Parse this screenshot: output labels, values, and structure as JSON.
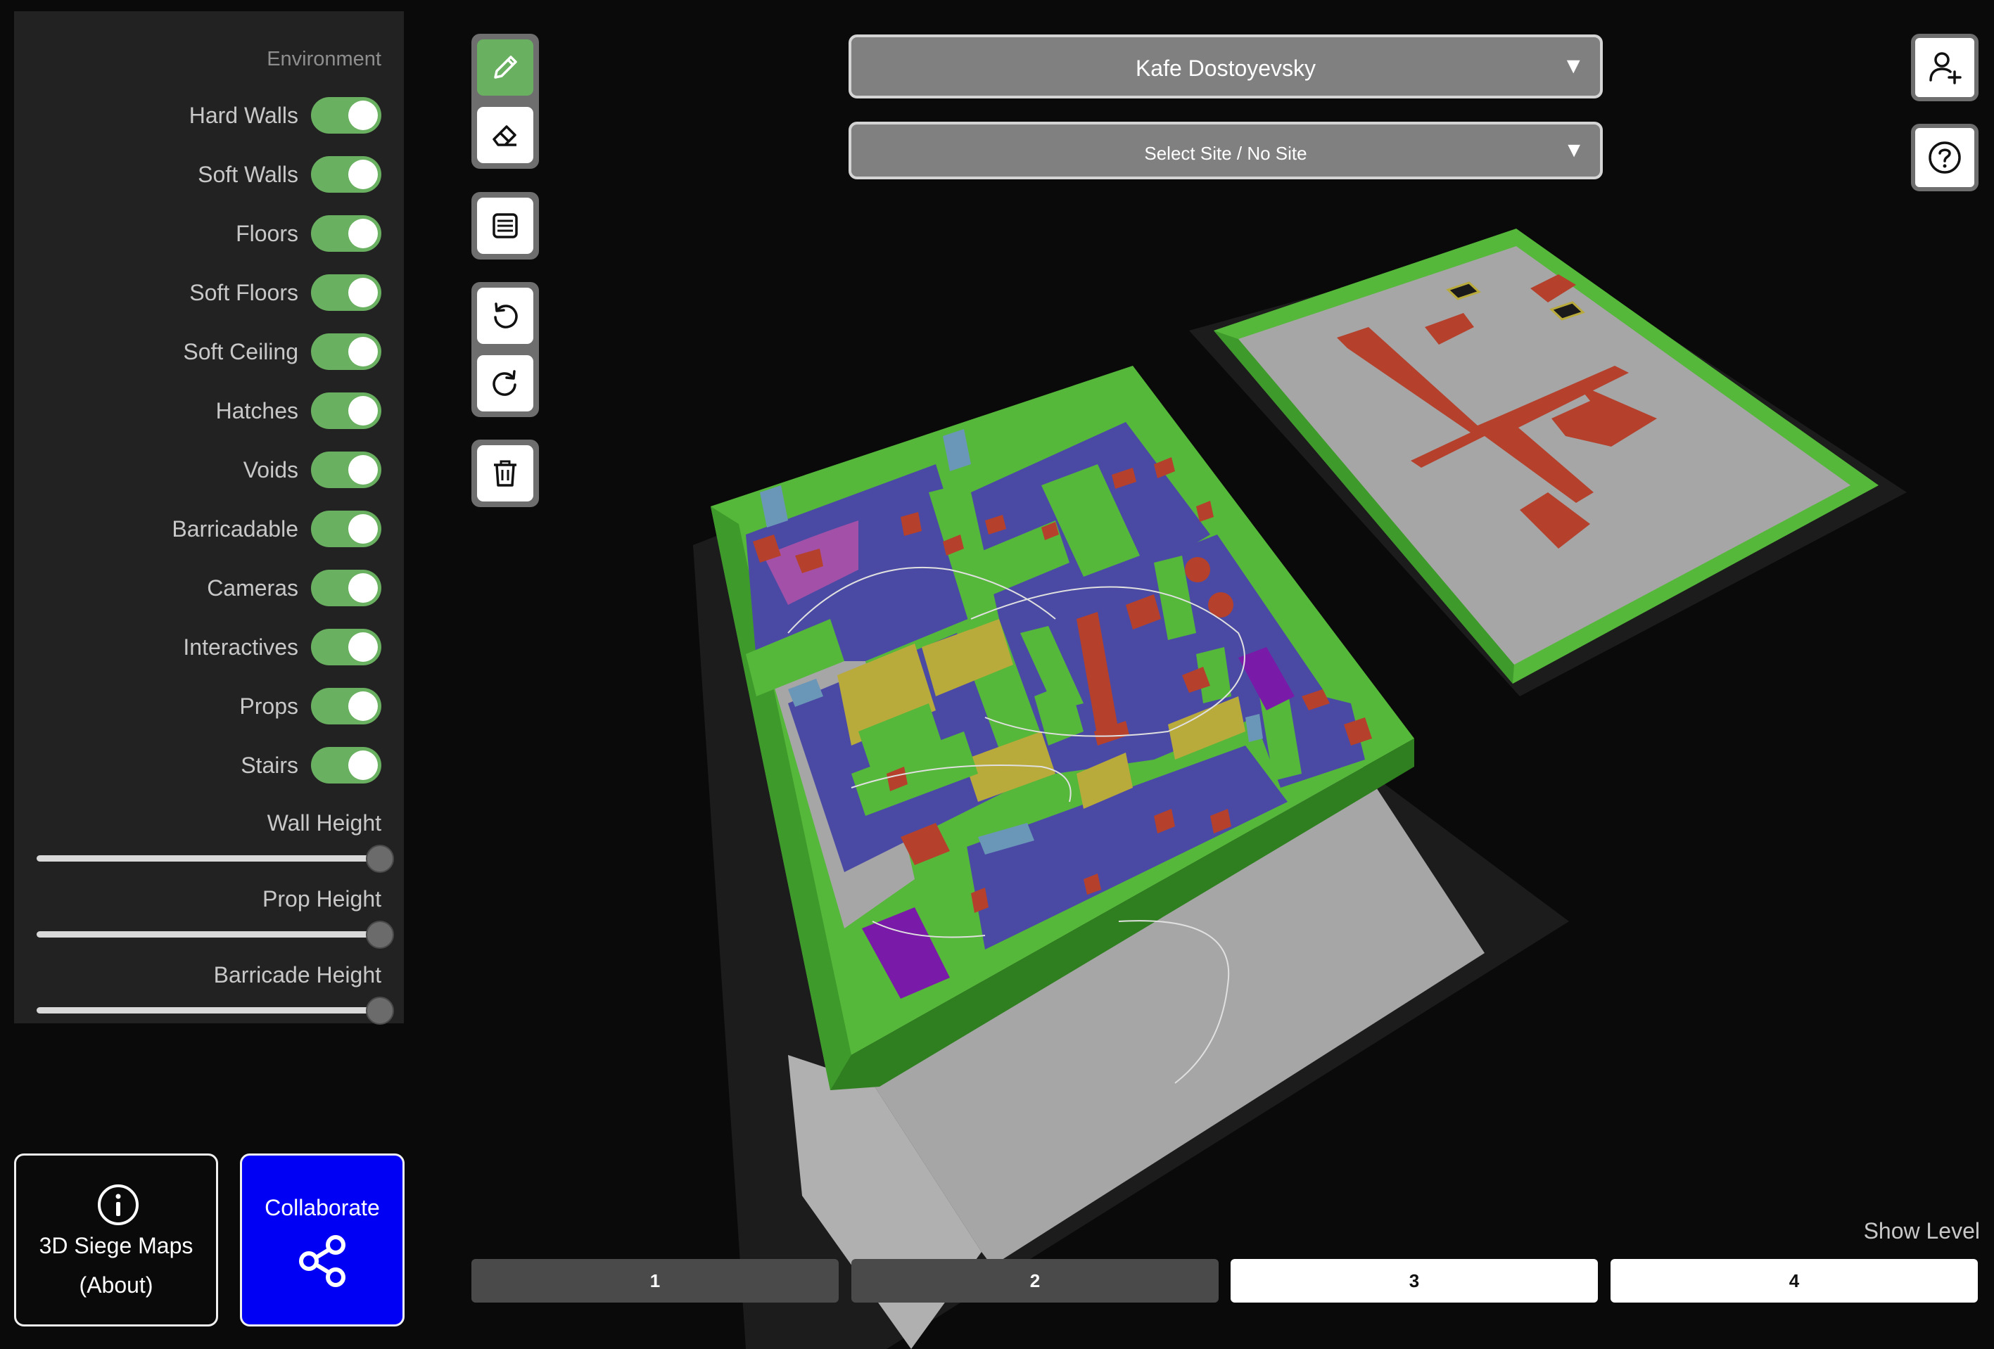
{
  "environment": {
    "title": "Environment",
    "toggles": [
      {
        "label": "Hard Walls",
        "on": true
      },
      {
        "label": "Soft Walls",
        "on": true
      },
      {
        "label": "Floors",
        "on": true
      },
      {
        "label": "Soft Floors",
        "on": true
      },
      {
        "label": "Soft Ceiling",
        "on": true
      },
      {
        "label": "Hatches",
        "on": true
      },
      {
        "label": "Voids",
        "on": true
      },
      {
        "label": "Barricadable",
        "on": true
      },
      {
        "label": "Cameras",
        "on": true
      },
      {
        "label": "Interactives",
        "on": true
      },
      {
        "label": "Props",
        "on": true
      },
      {
        "label": "Stairs",
        "on": true
      }
    ],
    "sliders": [
      {
        "label": "Wall Height",
        "value_fraction": 1.0
      },
      {
        "label": "Prop Height",
        "value_fraction": 1.0
      },
      {
        "label": "Barricade Height",
        "value_fraction": 1.0
      }
    ],
    "toggle_on_color": "#6ab061"
  },
  "about": {
    "line1": "3D Siege Maps",
    "line2": "(About)",
    "icon": "info-icon"
  },
  "collaborate": {
    "label": "Collaborate",
    "icon": "share-icon",
    "color": "#0000f5"
  },
  "tools": [
    {
      "icon": "pencil-icon",
      "active": true
    },
    {
      "icon": "eraser-icon",
      "active": false
    },
    {
      "icon": "list-icon",
      "active": false
    },
    {
      "icon": "undo-icon",
      "active": false
    },
    {
      "icon": "redo-icon",
      "active": false
    },
    {
      "icon": "trash-icon",
      "active": false
    }
  ],
  "map_select": {
    "value": "Kafe Dostoyevsky",
    "arrow": "▼"
  },
  "site_select": {
    "value": "Select Site / No Site",
    "arrow": "▼"
  },
  "corner_buttons": [
    {
      "icon": "add-user-icon"
    },
    {
      "icon": "help-icon"
    }
  ],
  "levels": {
    "label": "Show Level",
    "buttons": [
      {
        "label": "1",
        "selected": false
      },
      {
        "label": "2",
        "selected": false
      },
      {
        "label": "3",
        "selected": true
      },
      {
        "label": "4",
        "selected": true
      }
    ]
  },
  "scene_colors": {
    "hard_wall": "#56b83a",
    "floor": "#a6a6a6",
    "soft_floor": "#4a4aa4",
    "barricade": "#b9aa3c",
    "prop": "#b5412c",
    "stairs": "#7a1aa8"
  }
}
